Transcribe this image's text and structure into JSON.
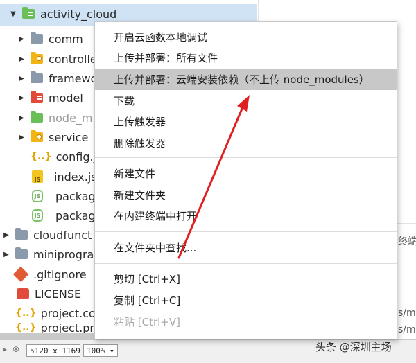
{
  "tree": {
    "items": [
      {
        "label": "activity_cloud",
        "icon": "folder-green",
        "expanded": true
      },
      {
        "label": "comm",
        "icon": "folder-gray"
      },
      {
        "label": "controlle",
        "icon": "folder-yellow"
      },
      {
        "label": "framewo",
        "icon": "folder-gray"
      },
      {
        "label": "model",
        "icon": "folder-red"
      },
      {
        "label": "node_m",
        "icon": "folder-green"
      },
      {
        "label": "service",
        "icon": "folder-yellow"
      },
      {
        "label": "config.js",
        "icon": "curly-braces"
      },
      {
        "label": "index.js",
        "icon": "js-file"
      },
      {
        "label": "package",
        "icon": "json-file"
      },
      {
        "label": "package",
        "icon": "json-file"
      },
      {
        "label": "cloudfunct",
        "icon": "folder-gray"
      },
      {
        "label": "miniprogra",
        "icon": "folder-gray"
      },
      {
        "label": ".gitignore",
        "icon": "git-file"
      },
      {
        "label": "LICENSE",
        "icon": "license-file"
      },
      {
        "label": "project.con",
        "icon": "curly-braces"
      },
      {
        "label": "project.priv",
        "icon": "curly-braces"
      }
    ]
  },
  "background_panel": {
    "tab_fragment": "终端",
    "path_fragment_1": "s/m",
    "path_fragment_2": "s/m"
  },
  "context_menu": {
    "items": [
      {
        "label": "开启云函数本地调试"
      },
      {
        "label": "上传并部署：所有文件"
      },
      {
        "label": "上传并部署：云端安装依赖（不上传 node_modules）",
        "highlighted": true
      },
      {
        "label": "下载"
      },
      {
        "label": "上传触发器"
      },
      {
        "label": "删除触发器"
      },
      {
        "label": "新建文件"
      },
      {
        "label": "新建文件夹"
      },
      {
        "label": "在内建终端中打开"
      },
      {
        "label": "在文件夹中查找..."
      },
      {
        "label": "剪切  [Ctrl+X]"
      },
      {
        "label": "复制  [Ctrl+C]"
      },
      {
        "label": "粘贴  [Ctrl+V]",
        "disabled": true
      }
    ]
  },
  "status_bar": {
    "dimensions": "5120 x 1169",
    "zoom": "100%",
    "zoom_arrow": "▾"
  },
  "watermark": "头条 @深圳主场",
  "colors": {
    "selection": "#cfe3f5",
    "menu_highlight": "#c8c8c8",
    "annotation_arrow": "#e02020"
  }
}
